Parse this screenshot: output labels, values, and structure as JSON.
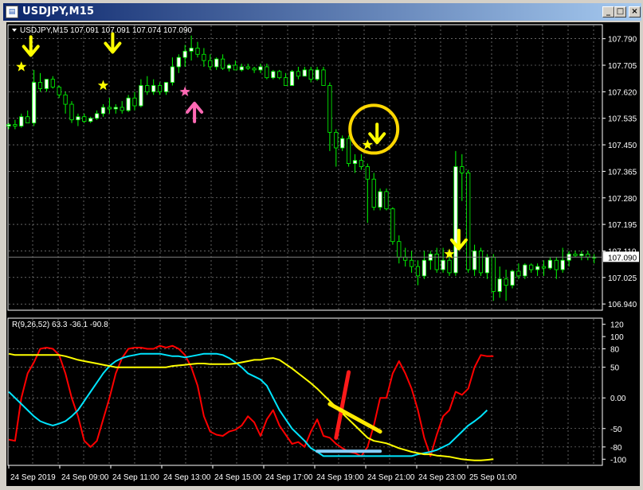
{
  "window": {
    "title": "USDJPY,M15",
    "icon": "chart-window-icon",
    "buttons": {
      "minimize": "_",
      "maximize": "□",
      "close": "×"
    }
  },
  "colors": {
    "background": "#000000",
    "grid": "#a0a0a0",
    "bull": "#ffffff",
    "bear": "#000000",
    "wick": "#00ff00",
    "price_line": "#808080",
    "fast": "#ff0000",
    "middle": "#00e5ff",
    "slow": "#ffff00",
    "signal_arrow": "#ffff00",
    "buy_arrow": "#ff69b4",
    "highlight_circle": "#ffd700",
    "mark_red": "#ff1a1a",
    "mark_yellow": "#ffea00",
    "mark_blue": "#87cefa"
  },
  "chart_data": [
    {
      "type": "candlestick",
      "header": "USDJPY,M15  107.091 107.091 107.074 107.090",
      "symbol": "USDJPY,M15",
      "last_bar_ohlc": [
        107.091,
        107.091,
        107.074,
        107.09
      ],
      "current_price": 107.09,
      "current_price_label": "107.090",
      "ylim": [
        106.92,
        107.835
      ],
      "y_ticks": [
        "107.790",
        "107.705",
        "107.620",
        "107.535",
        "107.450",
        "107.365",
        "107.280",
        "107.195",
        "107.110",
        "107.025",
        "106.940"
      ],
      "x_tick_labels": [
        "24 Sep 2019",
        "24 Sep 09:00",
        "24 Sep 11:00",
        "24 Sep 13:00",
        "24 Sep 15:00",
        "24 Sep 17:00",
        "24 Sep 19:00",
        "24 Sep 21:00",
        "24 Sep 23:00",
        "25 Sep 01:00"
      ],
      "grid": true,
      "ohlc": [
        [
          107.51,
          107.52,
          107.5,
          107.515
        ],
        [
          107.515,
          107.53,
          107.5,
          107.51
        ],
        [
          107.51,
          107.55,
          107.505,
          107.54
        ],
        [
          107.54,
          107.56,
          107.52,
          107.52
        ],
        [
          107.52,
          107.69,
          107.51,
          107.65
        ],
        [
          107.65,
          107.68,
          107.62,
          107.63
        ],
        [
          107.63,
          107.66,
          107.62,
          107.66
        ],
        [
          107.66,
          107.67,
          107.63,
          107.635
        ],
        [
          107.635,
          107.64,
          107.6,
          107.61
        ],
        [
          107.61,
          107.62,
          107.55,
          107.58
        ],
        [
          107.58,
          107.59,
          107.52,
          107.53
        ],
        [
          107.53,
          107.55,
          107.51,
          107.54
        ],
        [
          107.54,
          107.55,
          107.52,
          107.525
        ],
        [
          107.525,
          107.54,
          107.52,
          107.535
        ],
        [
          107.535,
          107.56,
          107.53,
          107.55
        ],
        [
          107.55,
          107.58,
          107.54,
          107.57
        ],
        [
          107.57,
          107.6,
          107.55,
          107.565
        ],
        [
          107.565,
          107.58,
          107.55,
          107.57
        ],
        [
          107.57,
          107.59,
          107.55,
          107.56
        ],
        [
          107.56,
          107.61,
          107.555,
          107.6
        ],
        [
          107.6,
          107.62,
          107.56,
          107.575
        ],
        [
          107.575,
          107.66,
          107.57,
          107.64
        ],
        [
          107.64,
          107.67,
          107.61,
          107.62
        ],
        [
          107.62,
          107.66,
          107.61,
          107.64
        ],
        [
          107.64,
          107.65,
          107.61,
          107.62
        ],
        [
          107.62,
          107.65,
          107.61,
          107.65
        ],
        [
          107.65,
          107.73,
          107.64,
          107.7
        ],
        [
          107.7,
          107.74,
          107.68,
          107.73
        ],
        [
          107.73,
          107.77,
          107.7,
          107.75
        ],
        [
          107.75,
          107.8,
          107.72,
          107.76
        ],
        [
          107.76,
          107.78,
          107.73,
          107.74
        ],
        [
          107.74,
          107.76,
          107.7,
          107.72
        ],
        [
          107.72,
          107.74,
          107.69,
          107.7
        ],
        [
          107.7,
          107.73,
          107.69,
          107.725
        ],
        [
          107.725,
          107.74,
          107.69,
          107.695
        ],
        [
          107.695,
          107.71,
          107.685,
          107.705
        ],
        [
          107.705,
          107.72,
          107.69,
          107.69
        ],
        [
          107.69,
          107.71,
          107.685,
          107.7
        ],
        [
          107.7,
          107.71,
          107.69,
          107.695
        ],
        [
          107.695,
          107.7,
          107.68,
          107.69
        ],
        [
          107.69,
          107.71,
          107.68,
          107.7
        ],
        [
          107.7,
          107.71,
          107.66,
          107.665
        ],
        [
          107.665,
          107.69,
          107.66,
          107.685
        ],
        [
          107.685,
          107.69,
          107.66,
          107.665
        ],
        [
          107.665,
          107.68,
          107.64,
          107.64
        ],
        [
          107.64,
          107.69,
          107.64,
          107.685
        ],
        [
          107.685,
          107.7,
          107.66,
          107.67
        ],
        [
          107.67,
          107.7,
          107.67,
          107.69
        ],
        [
          107.69,
          107.7,
          107.65,
          107.66
        ],
        [
          107.66,
          107.7,
          107.655,
          107.69
        ],
        [
          107.69,
          107.7,
          107.64,
          107.64
        ],
        [
          107.64,
          107.65,
          107.43,
          107.49
        ],
        [
          107.49,
          107.5,
          107.38,
          107.44
        ],
        [
          107.44,
          107.48,
          107.43,
          107.47
        ],
        [
          107.47,
          107.48,
          107.38,
          107.39
        ],
        [
          107.39,
          107.42,
          107.36,
          107.4
        ],
        [
          107.4,
          107.42,
          107.37,
          107.38
        ],
        [
          107.38,
          107.39,
          107.2,
          107.34
        ],
        [
          107.34,
          107.36,
          107.24,
          107.25
        ],
        [
          107.25,
          107.31,
          107.24,
          107.3
        ],
        [
          107.3,
          107.31,
          107.24,
          107.245
        ],
        [
          107.245,
          107.25,
          107.13,
          107.14
        ],
        [
          107.14,
          107.16,
          107.07,
          107.09
        ],
        [
          107.09,
          107.12,
          107.06,
          107.08
        ],
        [
          107.08,
          107.11,
          107.04,
          107.06
        ],
        [
          107.06,
          107.08,
          107.0,
          107.03
        ],
        [
          107.03,
          107.11,
          107.02,
          107.08
        ],
        [
          107.08,
          107.11,
          107.05,
          107.1
        ],
        [
          107.1,
          107.12,
          107.04,
          107.05
        ],
        [
          107.05,
          107.12,
          107.04,
          107.08
        ],
        [
          107.08,
          107.1,
          107.03,
          107.04
        ],
        [
          107.04,
          107.43,
          107.03,
          107.38
        ],
        [
          107.38,
          107.42,
          107.27,
          107.36
        ],
        [
          107.36,
          107.37,
          107.04,
          107.05
        ],
        [
          107.05,
          107.13,
          107.03,
          107.11
        ],
        [
          107.11,
          107.12,
          107.03,
          107.04
        ],
        [
          107.04,
          107.1,
          107.02,
          107.09
        ],
        [
          107.09,
          107.1,
          106.95,
          106.98
        ],
        [
          106.98,
          107.06,
          106.96,
          107.02
        ],
        [
          107.02,
          107.05,
          106.95,
          107.0
        ],
        [
          107.0,
          107.05,
          106.99,
          107.045
        ],
        [
          107.045,
          107.07,
          107.02,
          107.03
        ],
        [
          107.03,
          107.07,
          107.02,
          107.065
        ],
        [
          107.065,
          107.07,
          107.04,
          107.05
        ],
        [
          107.05,
          107.07,
          107.03,
          107.06
        ],
        [
          107.06,
          107.08,
          107.03,
          107.055
        ],
        [
          107.055,
          107.09,
          107.05,
          107.08
        ],
        [
          107.08,
          107.09,
          107.02,
          107.05
        ],
        [
          107.05,
          107.12,
          107.04,
          107.08
        ],
        [
          107.08,
          107.11,
          107.06,
          107.1
        ],
        [
          107.1,
          107.11,
          107.09,
          107.095
        ],
        [
          107.095,
          107.11,
          107.08,
          107.1
        ],
        [
          107.1,
          107.11,
          107.08,
          107.09
        ],
        [
          107.09,
          107.1,
          107.07,
          107.09
        ]
      ],
      "markers": [
        {
          "type": "arrow-down",
          "bar": 3,
          "price": 107.76
        },
        {
          "type": "star",
          "bar": 2,
          "price": 107.7
        },
        {
          "type": "arrow-down",
          "bar": 16,
          "price": 107.77
        },
        {
          "type": "star",
          "bar": 15,
          "price": 107.64
        },
        {
          "type": "star",
          "bar": 28,
          "price": 107.62
        },
        {
          "type": "arrow-up",
          "bar": 29,
          "price": 107.56
        },
        {
          "type": "arrow-down",
          "bar": 58,
          "price": 107.48
        },
        {
          "type": "star",
          "bar": 57,
          "price": 107.45
        },
        {
          "type": "circle",
          "bar": 58,
          "price": 107.5
        },
        {
          "type": "arrow-down",
          "bar": 71,
          "price": 107.14
        },
        {
          "type": "star",
          "bar": 70,
          "price": 107.1
        }
      ]
    },
    {
      "type": "line",
      "header": "R(9,26,52) 63.3 -36.1 -90.8",
      "ylim": [
        -110,
        130
      ],
      "y_ticks": [
        120,
        100,
        80,
        50,
        0,
        -50,
        -80,
        -100
      ],
      "y_tick_labels": [
        "120",
        "100",
        "80",
        "50",
        "0.00",
        "-50",
        "-80",
        "-100"
      ],
      "series": [
        {
          "color": "#ff0000",
          "values": [
            -68,
            -70,
            0,
            40,
            58,
            80,
            82,
            80,
            70,
            40,
            0,
            -30,
            -70,
            -80,
            -70,
            -35,
            0,
            40,
            65,
            80,
            82,
            82,
            80,
            80,
            85,
            82,
            85,
            80,
            70,
            50,
            20,
            -30,
            -55,
            -60,
            -62,
            -55,
            -52,
            -45,
            -30,
            -40,
            -62,
            -35,
            -20,
            -45,
            -60,
            -75,
            -72,
            -80,
            -55,
            -35,
            -62,
            -65,
            -75,
            -82,
            -88,
            -90,
            -95,
            -80,
            -45,
            0,
            0,
            40,
            60,
            40,
            15,
            -20,
            -65,
            -95,
            -60,
            -30,
            -20,
            10,
            5,
            15,
            50,
            70,
            68,
            68
          ]
        },
        {
          "color": "#00e5ff",
          "values": [
            10,
            0,
            -10,
            -20,
            -30,
            -38,
            -42,
            -45,
            -42,
            -38,
            -30,
            -20,
            -5,
            10,
            25,
            40,
            52,
            60,
            65,
            68,
            70,
            72,
            72,
            72,
            72,
            70,
            68,
            68,
            66,
            68,
            70,
            72,
            72,
            72,
            70,
            65,
            58,
            50,
            40,
            35,
            30,
            20,
            0,
            -20,
            -35,
            -50,
            -60,
            -70,
            -82,
            -88,
            -95,
            -95,
            -95,
            -95,
            -95,
            -95,
            -95,
            -95,
            -95,
            -95,
            -95,
            -95,
            -95,
            -95,
            -95,
            -92,
            -90,
            -88,
            -85,
            -80,
            -75,
            -65,
            -55,
            -45,
            -38,
            -30,
            -20
          ]
        },
        {
          "color": "#ffff00",
          "values": [
            72,
            70,
            70,
            70,
            70,
            70,
            70,
            70,
            70,
            68,
            65,
            62,
            60,
            58,
            56,
            54,
            52,
            50,
            50,
            50,
            50,
            50,
            50,
            50,
            50,
            50,
            52,
            53,
            54,
            55,
            56,
            56,
            55,
            55,
            55,
            55,
            56,
            58,
            60,
            62,
            62,
            64,
            65,
            62,
            55,
            48,
            40,
            32,
            24,
            15,
            5,
            -5,
            -15,
            -25,
            -35,
            -45,
            -55,
            -65,
            -70,
            -72,
            -74,
            -78,
            -82,
            -85,
            -88,
            -90,
            -92,
            -92,
            -94,
            -95,
            -96,
            -98,
            -100,
            -101,
            -102,
            -102,
            -101,
            -100
          ]
        }
      ],
      "markers": [
        {
          "type": "line",
          "color": "#ff1a1a",
          "from_bar": 52,
          "from_value": -65,
          "to_bar": 54,
          "to_value": 42
        },
        {
          "type": "line",
          "color": "#ffea00",
          "from_bar": 51,
          "from_value": -10,
          "to_bar": 59,
          "to_value": -55
        },
        {
          "type": "line",
          "color": "#87cefa",
          "from_bar": 49,
          "from_value": -87,
          "to_bar": 59,
          "to_value": -87
        }
      ]
    }
  ]
}
